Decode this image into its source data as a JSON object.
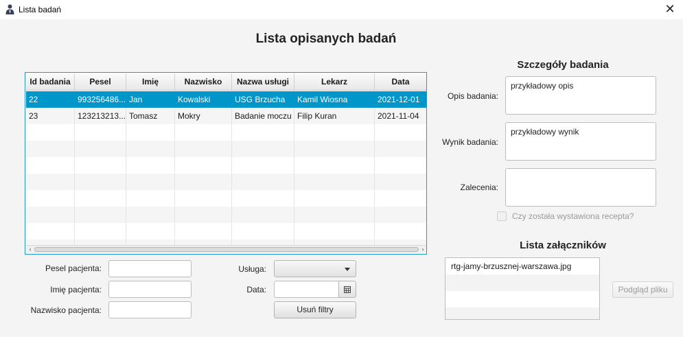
{
  "window": {
    "title": "Lista badań",
    "close_icon": "close-icon"
  },
  "page_title": "Lista opisanych badań",
  "table": {
    "columns": [
      "Id badania",
      "Pesel",
      "Imię",
      "Nazwisko",
      "Nazwa usługi",
      "Lekarz",
      "Data"
    ],
    "rows": [
      [
        "22",
        "993256486...",
        "Jan",
        "Kowalski",
        "USG Brzucha",
        "Kamil Wiosna",
        "2021-12-01"
      ],
      [
        "23",
        "123213213...",
        "Tomasz",
        "Mokry",
        "Badanie moczu",
        "Filip Kuran",
        "2021-11-04"
      ]
    ],
    "selected_row": 0,
    "accent_color": "#0096c9"
  },
  "filters": {
    "pesel_label": "Pesel pacjenta:",
    "imie_label": "Imię pacjenta:",
    "nazwisko_label": "Nazwisko pacjenta:",
    "pesel_value": "",
    "imie_value": "",
    "nazwisko_value": "",
    "usluga_label": "Usługa:",
    "usluga_value": "",
    "data_label": "Data:",
    "data_value": "",
    "calendar_icon": "calendar-icon",
    "clear_button": "Usuń filtry"
  },
  "details": {
    "title": "Szczegóły badania",
    "opis_label": "Opis badania:",
    "opis_value": "przykładowy opis",
    "wynik_label": "Wynik badania:",
    "wynik_value": "przykładowy wynik",
    "zalecenia_label": "Zalecenia:",
    "zalecenia_value": "",
    "recepta_label": "Czy została wystawiona recepta?",
    "recepta_checked": false
  },
  "attachments": {
    "title": "Lista załączników",
    "items": [
      "rtg-jamy-brzusznej-warszawa.jpg"
    ],
    "preview_button": "Podgląd pliku"
  }
}
